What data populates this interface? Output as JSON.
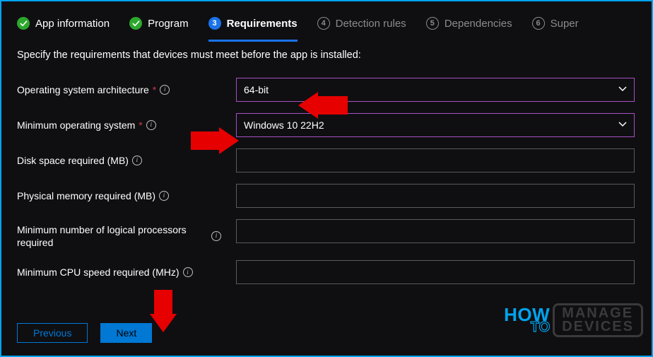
{
  "steps": {
    "s1": {
      "num": "1",
      "label": "App information"
    },
    "s2": {
      "num": "2",
      "label": "Program"
    },
    "s3": {
      "num": "3",
      "label": "Requirements"
    },
    "s4": {
      "num": "4",
      "label": "Detection rules"
    },
    "s5": {
      "num": "5",
      "label": "Dependencies"
    },
    "s6": {
      "num": "6",
      "label": "Super"
    }
  },
  "intro": "Specify the requirements that devices must meet before the app is installed:",
  "fields": {
    "osArch": {
      "label": "Operating system architecture",
      "value": "64-bit"
    },
    "minOS": {
      "label": "Minimum operating system",
      "value": "Windows 10 22H2"
    },
    "diskSpace": {
      "label": "Disk space required (MB)",
      "value": ""
    },
    "physMem": {
      "label": "Physical memory required (MB)",
      "value": ""
    },
    "minLogicalProc": {
      "label": "Minimum number of logical processors required",
      "value": ""
    },
    "minCPU": {
      "label": "Minimum CPU speed required (MHz)",
      "value": ""
    }
  },
  "required_marker": "*",
  "buttons": {
    "prev": "Previous",
    "next": "Next"
  },
  "watermark": {
    "how": "HOW",
    "to": "TO",
    "manage": "MANAGE",
    "devices": "DEVICES"
  }
}
